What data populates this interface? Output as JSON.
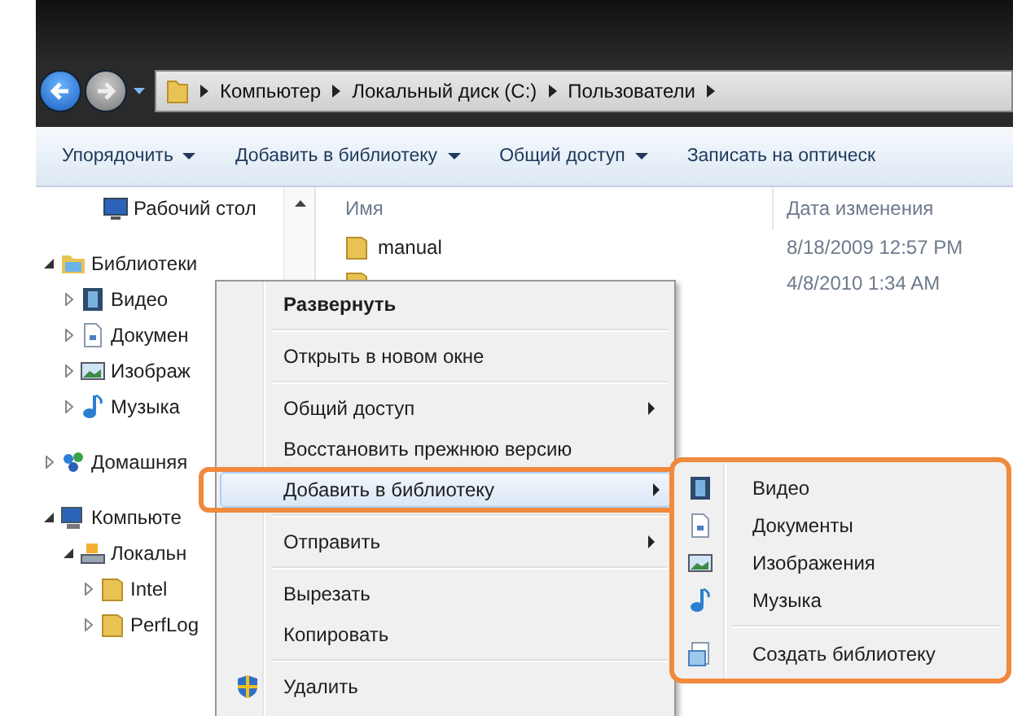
{
  "address_bar": {
    "segments": [
      "Компьютер",
      "Локальный диск (C:)",
      "Пользователи"
    ]
  },
  "toolbar": [
    {
      "label": "Упорядочить",
      "dropdown": true
    },
    {
      "label": "Добавить в библиотеку",
      "dropdown": true
    },
    {
      "label": "Общий доступ",
      "dropdown": true
    },
    {
      "label": "Записать на оптическ",
      "dropdown": false
    }
  ],
  "nav_tree": [
    {
      "label": "Рабочий стол"
    },
    {
      "label": "Библиотеки",
      "expanded": true,
      "children": [
        {
          "label": "Видео",
          "expanded": false
        },
        {
          "label": "Докумен",
          "expanded": false
        },
        {
          "label": "Изображ",
          "expanded": false
        },
        {
          "label": "Музыка",
          "expanded": false
        }
      ]
    },
    {
      "label": "Домашняя",
      "expanded": false
    },
    {
      "label": "Компьюте",
      "expanded": true,
      "children": [
        {
          "label": "Локальн",
          "expanded": true,
          "children": [
            {
              "label": "Intel",
              "expanded": false
            },
            {
              "label": "PerfLog",
              "expanded": false
            }
          ]
        }
      ]
    }
  ],
  "file_list": {
    "columns": [
      "Имя",
      "Дата изменения"
    ],
    "rows": [
      {
        "name": "manual",
        "date": "8/18/2009 12:57 PM"
      },
      {
        "date": "4/8/2010 1:34 AM"
      }
    ]
  },
  "context_menu": {
    "items": [
      {
        "label": "Развернуть",
        "bold": true,
        "submenu": false,
        "selected": false,
        "separator_before": false,
        "highlighted": false
      },
      {
        "label": "Открыть в новом окне",
        "bold": false,
        "submenu": false,
        "selected": false,
        "separator_before": true,
        "highlighted": false
      },
      {
        "label": "Общий доступ",
        "bold": false,
        "submenu": true,
        "selected": false,
        "separator_before": true,
        "highlighted": false
      },
      {
        "label": "Восстановить прежнюю версию",
        "bold": false,
        "submenu": false,
        "selected": false,
        "separator_before": false,
        "highlighted": false
      },
      {
        "label": "Добавить в библиотеку",
        "bold": false,
        "submenu": true,
        "selected": true,
        "separator_before": false,
        "highlighted": true
      },
      {
        "label": "Отправить",
        "bold": false,
        "submenu": true,
        "selected": false,
        "separator_before": true,
        "highlighted": false
      },
      {
        "label": "Вырезать",
        "bold": false,
        "submenu": false,
        "selected": false,
        "separator_before": true,
        "highlighted": false
      },
      {
        "label": "Копировать",
        "bold": false,
        "submenu": false,
        "selected": false,
        "separator_before": false,
        "highlighted": false
      },
      {
        "label": "Удалить",
        "bold": false,
        "submenu": false,
        "selected": false,
        "separator_before": true,
        "highlighted": false
      }
    ]
  },
  "submenu": {
    "highlighted": true,
    "items": [
      {
        "label": "Видео",
        "separator_before": false
      },
      {
        "label": "Документы",
        "separator_before": false
      },
      {
        "label": "Изображения",
        "separator_before": false
      },
      {
        "label": "Музыка",
        "separator_before": false
      },
      {
        "label": "Создать библиотеку",
        "separator_before": true
      }
    ]
  }
}
